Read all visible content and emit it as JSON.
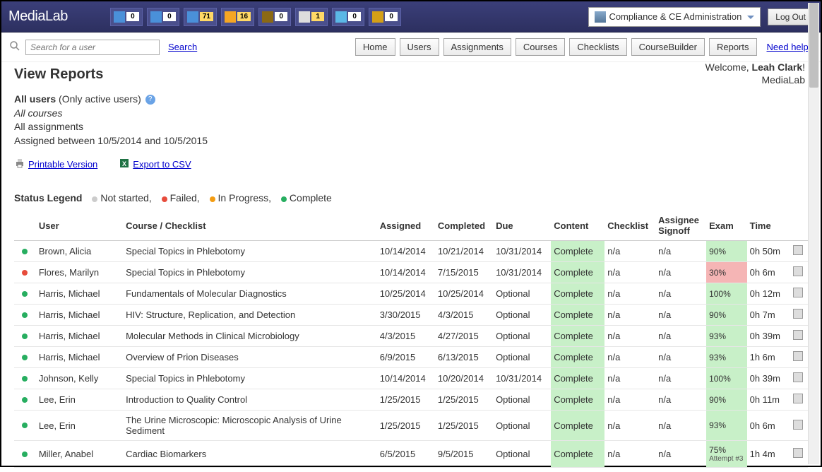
{
  "header": {
    "logo": "MediaLab",
    "nav_badges": [
      "0",
      "0",
      "71",
      "16",
      "0",
      "1",
      "0",
      "0"
    ],
    "admin_dropdown": "Compliance & CE Administration",
    "logout": "Log Out"
  },
  "tabs": {
    "search_placeholder": "Search for a user",
    "search_link": "Search",
    "items": [
      "Home",
      "Users",
      "Assignments",
      "Courses",
      "Checklists",
      "CourseBuilder",
      "Reports"
    ],
    "help": "Need help?"
  },
  "welcome": {
    "line1_pre": "Welcome, ",
    "name": "Leah Clark",
    "line2": "MediaLab"
  },
  "page_title": "View Reports",
  "filters": {
    "l1_b": "All users",
    "l1_rest": " (Only active users)",
    "l2": "All courses",
    "l3": "All assignments",
    "l4": "Assigned between 10/5/2014 and 10/5/2015"
  },
  "exports": {
    "print": "Printable Version",
    "csv": "Export to CSV"
  },
  "legend": {
    "label": "Status Legend",
    "not_started": "Not started,",
    "failed": "Failed,",
    "in_progress": "In Progress,",
    "complete": "Complete"
  },
  "columns": [
    "",
    "User",
    "Course / Checklist",
    "Assigned",
    "Completed",
    "Due",
    "Content",
    "Checklist",
    "Assignee Signoff",
    "Exam",
    "Time",
    ""
  ],
  "rows": [
    {
      "status": "green",
      "user": "Brown, Alicia",
      "course": "Special Topics in Phlebotomy",
      "assigned": "10/14/2014",
      "completed": "10/21/2014",
      "due": "10/31/2014",
      "content": "Complete",
      "checklist": "n/a",
      "signoff": "n/a",
      "exam": "90%",
      "exam_class": "green",
      "time": "0h 50m"
    },
    {
      "status": "red",
      "user": "Flores, Marilyn",
      "course": "Special Topics in Phlebotomy",
      "assigned": "10/14/2014",
      "completed": "7/15/2015",
      "due": "10/31/2014",
      "content": "Complete",
      "checklist": "n/a",
      "signoff": "n/a",
      "exam": "30%",
      "exam_class": "red",
      "time": "0h 6m"
    },
    {
      "status": "green",
      "user": "Harris, Michael",
      "course": "Fundamentals of Molecular Diagnostics",
      "assigned": "10/25/2014",
      "completed": "10/25/2014",
      "due": "Optional",
      "content": "Complete",
      "checklist": "n/a",
      "signoff": "n/a",
      "exam": "100%",
      "exam_class": "green",
      "time": "0h 12m"
    },
    {
      "status": "green",
      "user": "Harris, Michael",
      "course": "HIV: Structure, Replication, and Detection",
      "assigned": "3/30/2015",
      "completed": "4/3/2015",
      "due": "Optional",
      "content": "Complete",
      "checklist": "n/a",
      "signoff": "n/a",
      "exam": "90%",
      "exam_class": "green",
      "time": "0h 7m"
    },
    {
      "status": "green",
      "user": "Harris, Michael",
      "course": "Molecular Methods in Clinical Microbiology",
      "assigned": "4/3/2015",
      "completed": "4/27/2015",
      "due": "Optional",
      "content": "Complete",
      "checklist": "n/a",
      "signoff": "n/a",
      "exam": "93%",
      "exam_class": "green",
      "time": "0h 39m"
    },
    {
      "status": "green",
      "user": "Harris, Michael",
      "course": "Overview of Prion Diseases",
      "assigned": "6/9/2015",
      "completed": "6/13/2015",
      "due": "Optional",
      "content": "Complete",
      "checklist": "n/a",
      "signoff": "n/a",
      "exam": "93%",
      "exam_class": "green",
      "time": "1h 6m"
    },
    {
      "status": "green",
      "user": "Johnson, Kelly",
      "course": "Special Topics in Phlebotomy",
      "assigned": "10/14/2014",
      "completed": "10/20/2014",
      "due": "10/31/2014",
      "content": "Complete",
      "checklist": "n/a",
      "signoff": "n/a",
      "exam": "100%",
      "exam_class": "green",
      "time": "0h 39m"
    },
    {
      "status": "green",
      "user": "Lee, Erin",
      "course": "Introduction to Quality Control",
      "assigned": "1/25/2015",
      "completed": "1/25/2015",
      "due": "Optional",
      "content": "Complete",
      "checklist": "n/a",
      "signoff": "n/a",
      "exam": "90%",
      "exam_class": "green",
      "time": "0h 11m"
    },
    {
      "status": "green",
      "user": "Lee, Erin",
      "course": "The Urine Microscopic: Microscopic Analysis of Urine Sediment",
      "assigned": "1/25/2015",
      "completed": "1/25/2015",
      "due": "Optional",
      "content": "Complete",
      "checklist": "n/a",
      "signoff": "n/a",
      "exam": "93%",
      "exam_class": "green",
      "time": "0h 6m"
    },
    {
      "status": "green",
      "user": "Miller, Anabel",
      "course": "Cardiac Biomarkers",
      "assigned": "6/5/2015",
      "completed": "9/5/2015",
      "due": "Optional",
      "content": "Complete",
      "checklist": "n/a",
      "signoff": "n/a",
      "exam": "75%",
      "exam_note": "Attempt #3",
      "exam_class": "green",
      "time": "1h 4m"
    }
  ]
}
